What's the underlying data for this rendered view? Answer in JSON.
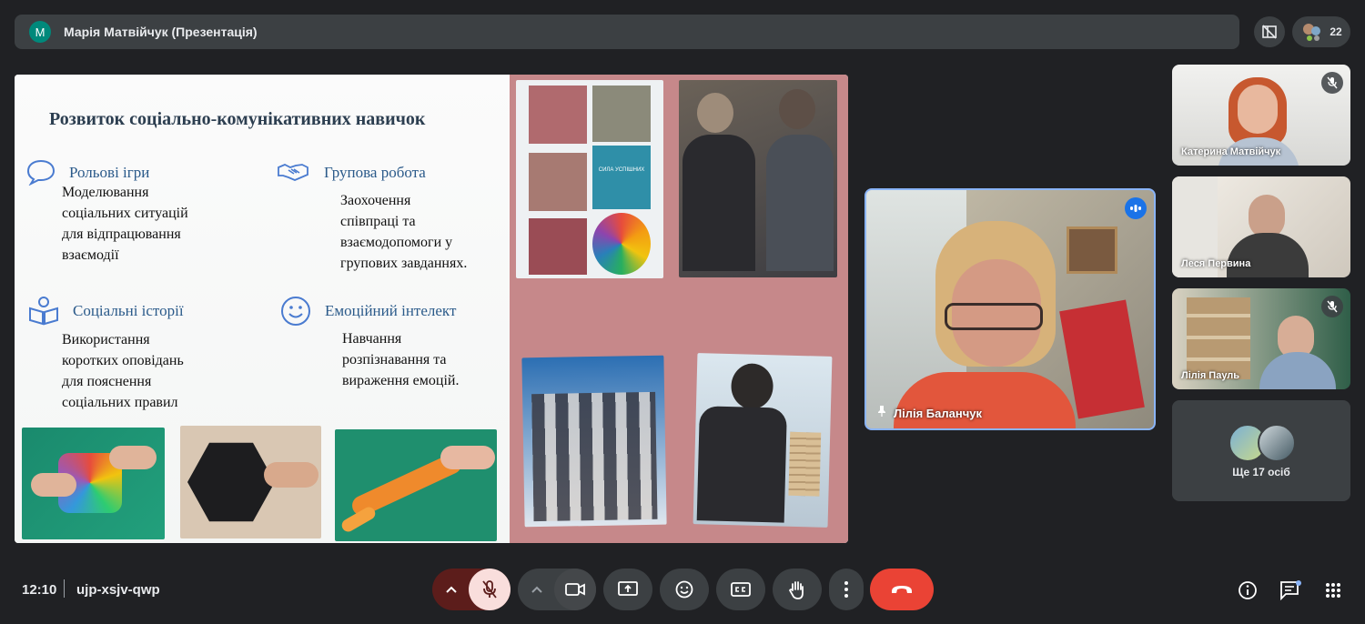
{
  "header": {
    "avatar_letter": "M",
    "presenter_title": "Марія Матвійчук (Презентація)",
    "participant_count": "22"
  },
  "slide": {
    "title": "Розвиток соціально-комунікативних навичок",
    "sections": [
      {
        "heading": "Рольові ігри",
        "text": "Моделювання\nсоціальних ситуацій\nдля відпрацювання\nвзаємодії",
        "icon": "speech-bubble-icon"
      },
      {
        "heading": "Групова робота",
        "text": "Заохочення\nспівпраці та\nвзаємодопомоги у\nгрупових завданнях.",
        "icon": "handshake-icon"
      },
      {
        "heading": "Соціальні історії",
        "text": "Використання\nкоротких оповідань\nдля пояснення\nсоціальних правил",
        "icon": "open-book-icon"
      },
      {
        "heading": "Емоційний інтелект",
        "text": "Навчання\nрозпізнавання та\nвираження емоцій.",
        "icon": "smiley-icon"
      }
    ],
    "poster_text": "СИЛА УСПІШНИХ"
  },
  "main_speaker": {
    "name": "Лілія Баланчук"
  },
  "participants": [
    {
      "name": "Катерина Матвійчук",
      "muted": true
    },
    {
      "name": "Леся Первина",
      "muted": false
    },
    {
      "name": "Лілія Пауль",
      "muted": true
    }
  ],
  "more_tile": {
    "label": "Ще 17 осіб"
  },
  "bottom": {
    "time": "12:10",
    "meeting_code": "ujp-xsjv-qwp"
  },
  "colors": {
    "background": "#202124",
    "surface": "#3c4043",
    "end_call": "#ea4335",
    "mic_off": "#f9dedc",
    "slide_accent": "#c6888a"
  }
}
